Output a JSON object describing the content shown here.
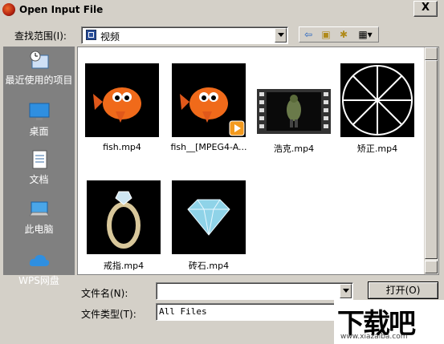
{
  "window": {
    "title": "Open Input File",
    "close_label": "X"
  },
  "lookin": {
    "label": "查找范围(I):",
    "value": "视频"
  },
  "toolbar": [
    {
      "name": "back-icon",
      "glyph": "⇦"
    },
    {
      "name": "up-folder-icon",
      "glyph": "▣"
    },
    {
      "name": "new-folder-icon",
      "glyph": "✱"
    },
    {
      "name": "view-menu-icon",
      "glyph": "▦▾"
    }
  ],
  "places": [
    {
      "label": "最近使用的项目",
      "icon": "recent-icon"
    },
    {
      "label": "桌面",
      "icon": "desktop-icon"
    },
    {
      "label": "文档",
      "icon": "documents-icon"
    },
    {
      "label": "此电脑",
      "icon": "computer-icon"
    },
    {
      "label": "WPS网盘",
      "icon": "cloud-icon"
    }
  ],
  "files": [
    {
      "name": "fish.mp4",
      "thumb": "fish"
    },
    {
      "name": "fish__[MPEG4-A...",
      "thumb": "fish-badge"
    },
    {
      "name": "浩克.mp4",
      "thumb": "film"
    },
    {
      "name": "矫正.mp4",
      "thumb": "wheel"
    },
    {
      "name": "戒指.mp4",
      "thumb": "ring"
    },
    {
      "name": "砖石.mp4",
      "thumb": "diamond"
    }
  ],
  "filename": {
    "label": "文件名(N):",
    "value": ""
  },
  "filetype": {
    "label": "文件类型(T):",
    "value": "All Files"
  },
  "buttons": {
    "open": "打开(O)"
  },
  "watermark": {
    "main": "下载吧",
    "url": "www.xiazaiba.com"
  }
}
